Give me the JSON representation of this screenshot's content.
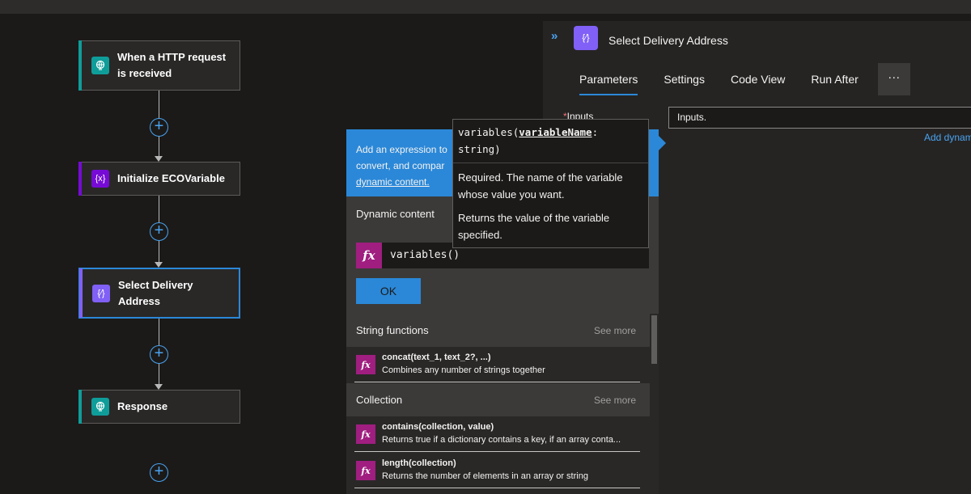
{
  "workflow": {
    "steps": [
      {
        "title_line1": "When a HTTP request",
        "title_line2": "is received",
        "icon": "http-request-icon",
        "color": "#0f9d9a"
      },
      {
        "title": "Initialize ECOVariable",
        "icon": "variable-icon",
        "icon_text": "{x}",
        "color": "#770bd6"
      },
      {
        "title_line1": "Select Delivery",
        "title_line2": "Address",
        "icon": "data-operation-icon",
        "icon_text": "{⁄}",
        "color": "#8060f6"
      },
      {
        "title": "Response",
        "icon": "response-icon",
        "color": "#0f9d9a"
      }
    ],
    "add_symbol": "+"
  },
  "panel": {
    "expand_symbol": "»",
    "icon_text": "{⁄}",
    "title": "Select Delivery Address",
    "tabs": [
      "Parameters",
      "Settings",
      "Code View",
      "Run After"
    ],
    "active_tab": "Parameters",
    "more_symbol": "···",
    "inputs_required_mark": "*",
    "inputs_label": "Inputs",
    "inputs_value": "Inputs.",
    "add_dynamic": "Add dynamic content"
  },
  "flyout": {
    "info_line1": "Add an expression to",
    "info_line2": "convert, and compar",
    "info_link": "dynamic content.",
    "tab_label": "Dynamic content",
    "fx_symbol": "fx",
    "expression": "variables()",
    "ok_label": "OK",
    "sections": [
      {
        "title": "String functions",
        "see_more": "See more",
        "items": [
          {
            "name": "concat(text_1, text_2?, ...)",
            "desc": "Combines any number of strings together"
          }
        ]
      },
      {
        "title": "Collection",
        "see_more": "See more",
        "items": [
          {
            "name": "contains(collection, value)",
            "desc": "Returns true if a dictionary contains a key, if an array conta..."
          },
          {
            "name": "length(collection)",
            "desc": "Returns the number of elements in an array or string"
          }
        ]
      }
    ]
  },
  "tooltip": {
    "sig_prefix": "variables(",
    "sig_param": "variableName",
    "sig_suffix": ":",
    "sig_type": "string)",
    "param_desc": "Required. The name of the variable whose value you want.",
    "return_desc": "Returns the value of the variable specified."
  },
  "colors": {
    "accent": "#2b88d8",
    "function": "#a01e80",
    "trigger": "#0f9d9a",
    "variable": "#770bd6",
    "data_op": "#8060f6"
  }
}
